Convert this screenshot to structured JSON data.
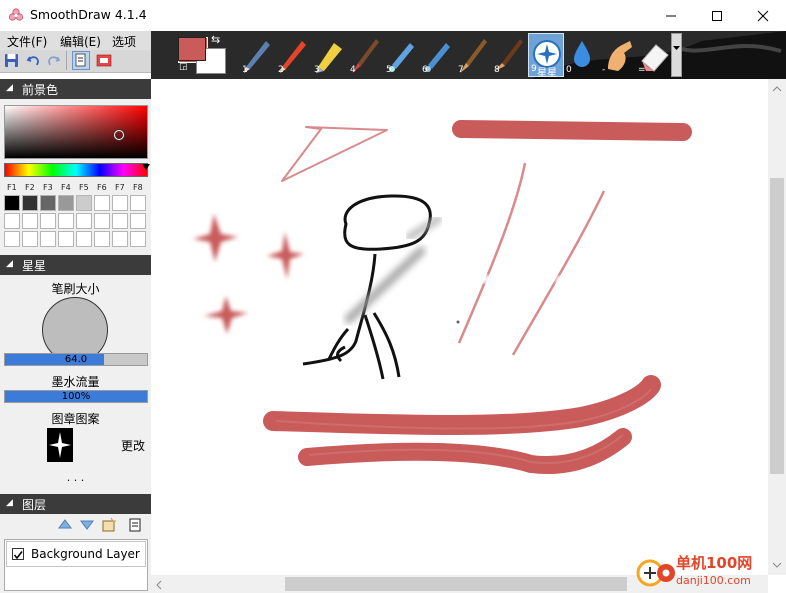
{
  "window": {
    "title": "SmoothDraw 4.1.4",
    "controls": [
      "—",
      "☐",
      "✕"
    ]
  },
  "menu": [
    {
      "label": "文件(F)"
    },
    {
      "label": "编辑(E)"
    },
    {
      "label": "选项(O)"
    }
  ],
  "colors": {
    "foreground": "#c95b5b",
    "background": "#ffffff",
    "accent": "#3d7bd9",
    "panel_header": "#3b3b3b"
  },
  "tools": [
    {
      "num": "1",
      "icon": "pen-icon"
    },
    {
      "num": "2",
      "icon": "pencil-icon"
    },
    {
      "num": "3",
      "icon": "marker-icon"
    },
    {
      "num": "4",
      "icon": "brush-icon"
    },
    {
      "num": "5",
      "icon": "airbrush-icon"
    },
    {
      "num": "6",
      "icon": "airbrush2-icon"
    },
    {
      "num": "7",
      "icon": "paintbrush-icon"
    },
    {
      "num": "8",
      "icon": "flat-brush-icon"
    },
    {
      "num": "9",
      "icon": "stars-icon",
      "active": true,
      "label": "星星"
    },
    {
      "num": "0",
      "icon": "water-drop-icon"
    },
    {
      "num": "-",
      "icon": "finger-smudge-icon"
    },
    {
      "num": "=",
      "icon": "eraser-icon"
    }
  ],
  "panels": {
    "foreground_title": "前景色",
    "function_keys": [
      "F1",
      "F2",
      "F3",
      "F4",
      "F5",
      "F6",
      "F7",
      "F8"
    ],
    "palette_row1": [
      "#000000",
      "#333333",
      "#666666",
      "#999999",
      "#cccccc",
      "#ffffff",
      "#ffffff",
      "#ffffff"
    ],
    "brush_title": "星星",
    "brush_size_label": "笔刷大小",
    "brush_size_value": "64.0",
    "brush_size_fraction": 0.7,
    "ink_flow_label": "墨水流量",
    "ink_flow_value": "100%",
    "ink_flow_fraction": 1.0,
    "stamp_label": "图章图案",
    "stamp_change": "更改",
    "more": ". . .",
    "layers_title": "图层",
    "layer_name": "Background Layer",
    "layer_visible": true
  },
  "watermark": {
    "site_name": "单机100网",
    "site_url": "danji100.com"
  }
}
